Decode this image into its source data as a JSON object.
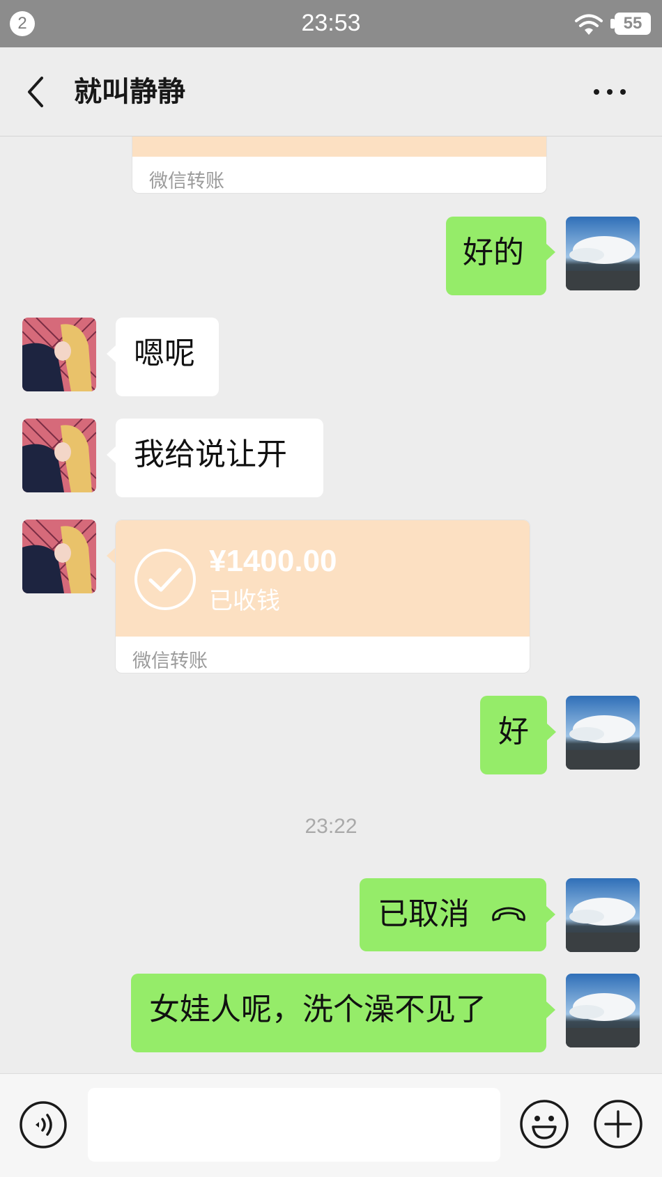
{
  "status_bar": {
    "notification_count": "2",
    "time": "23:53",
    "battery": "55"
  },
  "nav": {
    "title": "就叫静静"
  },
  "messages": {
    "transfer_top_footer": "微信转账",
    "m1": "好的",
    "m2": "嗯呢",
    "m3": "我给说让开",
    "transfer": {
      "amount": "¥1400.00",
      "status": "已收钱",
      "footer": "微信转账"
    },
    "m4": "好",
    "timestamp": "23:22",
    "m5": "已取消",
    "m6": "女娃人呢，洗个澡不见了"
  },
  "colors": {
    "my_bubble": "#95ec69",
    "their_bubble": "#ffffff",
    "transfer_bg": "#fce0c2"
  },
  "icons": [
    "back-icon",
    "more-icon",
    "wifi-icon",
    "check-icon",
    "hangup-icon",
    "voice-icon",
    "emoji-icon",
    "plus-icon"
  ]
}
